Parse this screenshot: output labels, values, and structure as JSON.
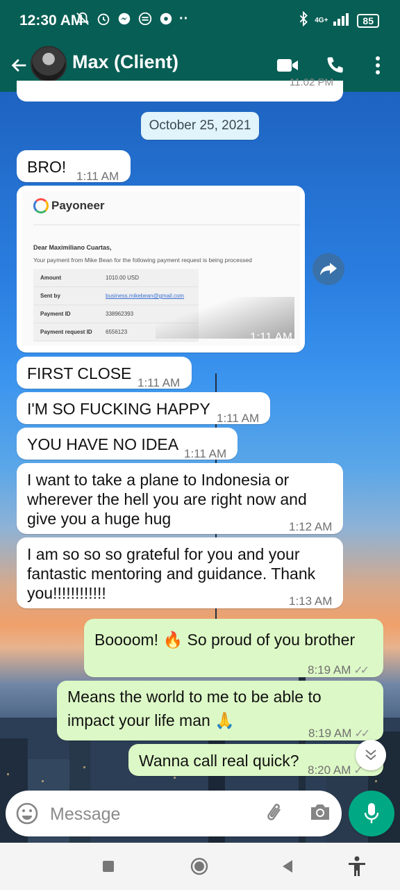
{
  "status_bar": {
    "time": "12:30 AM",
    "network": "4G+",
    "battery": "85"
  },
  "header": {
    "contact_name": "Max (Client)"
  },
  "chat": {
    "previous_time": "11:02 PM",
    "date_chip": "October 25, 2021",
    "messages": [
      {
        "text": "BRO!",
        "time": "1:11 AM"
      },
      {
        "text": "FIRST CLOSE",
        "time": "1:11 AM"
      },
      {
        "text": "I'M SO FUCKING HAPPY",
        "time": "1:11 AM"
      },
      {
        "text": "YOU HAVE NO IDEA",
        "time": "1:11 AM"
      },
      {
        "line1": "I want to take a plane to Indonesia or",
        "line2": "wherever the hell you are right now and",
        "line3": "give you a huge hug",
        "time": "1:12 AM"
      },
      {
        "line1": "I am so so so grateful for you and your",
        "line2": "fantastic mentoring and guidance. Thank",
        "line3": "you!!!!!!!!!!!!",
        "time": "1:13 AM"
      },
      {
        "text": "Boooom! 🔥 So proud of you brother",
        "time": "8:19 AM"
      },
      {
        "line1": "Means the world to me to be able to",
        "line2": "impact your life man 🙏",
        "time": "8:19 AM"
      },
      {
        "text": "Wanna call real quick?",
        "time": "8:20 AM"
      }
    ],
    "image_time": "1:11 AM"
  },
  "payoneer": {
    "brand": "Payoneer",
    "greeting": "Dear Maximiliano Cuartas,",
    "message": "Your payment from Mike Bean for the following payment request is being processed",
    "rows": [
      {
        "label": "Amount",
        "value": "1010.00 USD"
      },
      {
        "label": "Sent by",
        "value": "business.mikebean@gmail.com"
      },
      {
        "label": "Payment ID",
        "value": "338962393"
      },
      {
        "label": "Payment request ID",
        "value": "6556123"
      }
    ]
  },
  "composer": {
    "placeholder": "Message"
  },
  "colors": {
    "header": "#075E54",
    "outgoing_bubble": "#dcf8c6",
    "mic_button": "#00a884",
    "date_chip": "#e1f3fb"
  },
  "icons": [
    "back-arrow-icon",
    "video-call-icon",
    "phone-icon",
    "more-vert-icon",
    "forward-icon",
    "double-chevron-down-icon",
    "emoji-icon",
    "attach-icon",
    "camera-icon",
    "mic-icon",
    "nav-square-icon",
    "nav-circle-icon",
    "nav-back-icon",
    "accessibility-icon",
    "silent-icon",
    "alarm-icon",
    "messenger-icon",
    "bluetooth-icon",
    "signal-icon"
  ]
}
